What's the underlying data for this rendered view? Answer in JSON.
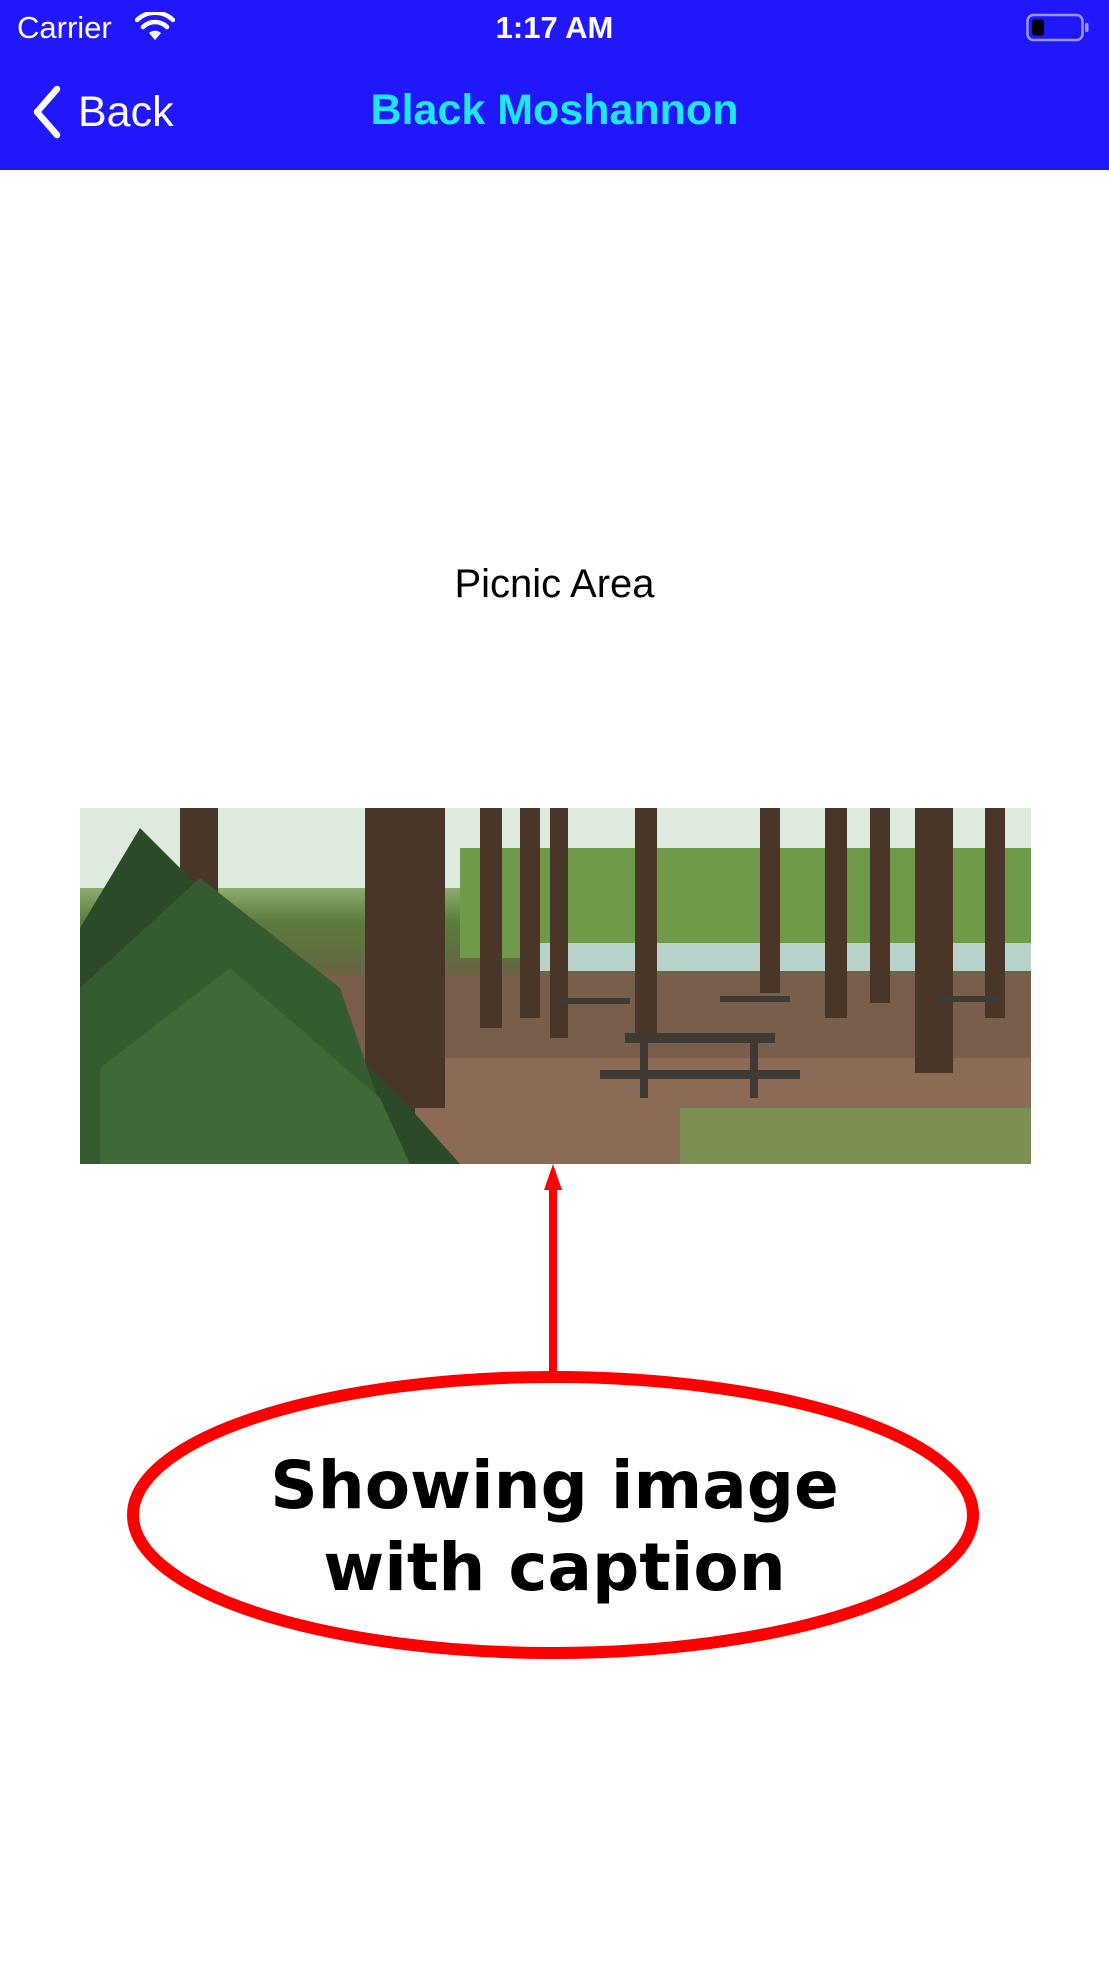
{
  "status_bar": {
    "carrier": "Carrier",
    "time": "1:17 AM",
    "icons": [
      "wifi-icon",
      "battery-icon"
    ]
  },
  "nav": {
    "back_label": "Back",
    "title": "Black Moshannon",
    "bar_color": "#2018fb",
    "title_color": "#1ee6f2"
  },
  "content": {
    "caption": "Picnic Area",
    "image_description_icon": "photo-picnic-area"
  },
  "annotation": {
    "line1": "Showing image",
    "line2": "with caption",
    "color": "#ff0000"
  }
}
